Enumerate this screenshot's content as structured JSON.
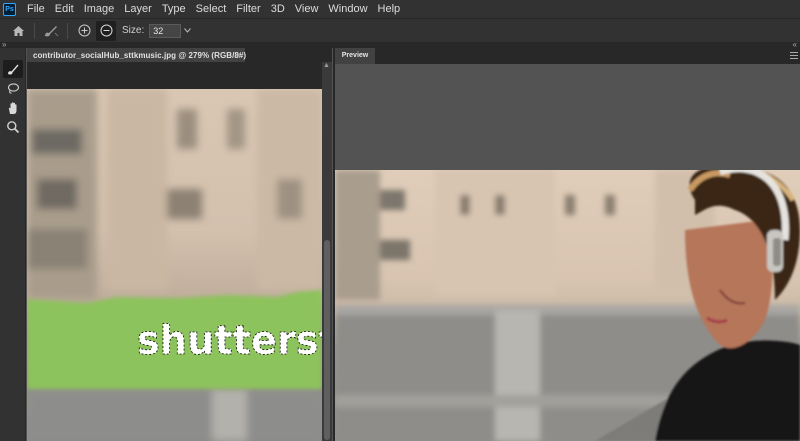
{
  "app": {
    "logo": "Ps"
  },
  "menu": [
    "File",
    "Edit",
    "Image",
    "Layer",
    "Type",
    "Select",
    "Filter",
    "3D",
    "View",
    "Window",
    "Help"
  ],
  "options": {
    "size_label": "Size:",
    "size_value": "32"
  },
  "document": {
    "tab_title": "contributor_socialHub_sttkmusic.jpg @ 279% (RGB/8#)",
    "close_glyph": "×"
  },
  "canvas": {
    "watermark": "shutterst"
  },
  "preview": {
    "tab_label": "Preview"
  },
  "colors": {
    "chrome": "#323232",
    "workspace": "#535353",
    "mask_green": "#8dc35c",
    "accent": "#31a8ff"
  }
}
